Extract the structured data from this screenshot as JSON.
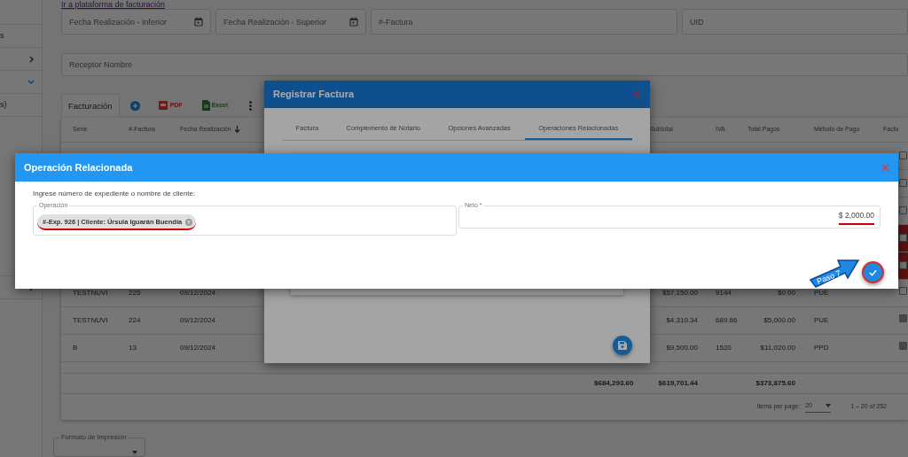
{
  "sidebar": {
    "items": [
      {
        "kind": "text",
        "label": "s"
      },
      {
        "kind": "group",
        "expanded": false
      },
      {
        "kind": "group",
        "expanded": true
      },
      {
        "kind": "text",
        "label": "s)"
      }
    ],
    "lower_items": [
      {
        "kind": "group",
        "expanded": false
      }
    ]
  },
  "link": "Ir a plataforma de facturación",
  "filters": [
    {
      "placeholder": "Fecha Realización - Inferior",
      "calendar": true
    },
    {
      "placeholder": "Fecha Realización - Superior",
      "calendar": true
    },
    {
      "placeholder": "#-Factura",
      "calendar": false
    },
    {
      "placeholder": "UID",
      "calendar": false
    }
  ],
  "receptor": {
    "placeholder": "Receptor Nombre"
  },
  "toolbar": {
    "tab": "Facturación",
    "pdf": "PDF",
    "excel": "Excel"
  },
  "table": {
    "columns": [
      {
        "label": "Serie",
        "sorted": false
      },
      {
        "label": "#-Factura",
        "sorted": false
      },
      {
        "label": "Fecha Realización",
        "sorted": true
      },
      {
        "label": "Subtotal",
        "sorted": false
      },
      {
        "label": "IVA",
        "sorted": false
      },
      {
        "label": "Total Pagos",
        "sorted": false
      },
      {
        "label": "Método de Pago",
        "sorted": false
      },
      {
        "label": "Factu",
        "sorted": false
      }
    ],
    "hidden_rows": [
      {
        "checked": false,
        "flagged": false
      },
      {
        "checked": false,
        "flagged": false
      },
      {
        "checked": false,
        "flagged": false
      },
      {
        "checked": false,
        "flagged": true
      },
      {
        "checked": false,
        "flagged": true
      }
    ],
    "rows": [
      {
        "serie": "TESTNUVI",
        "factura": "225",
        "fecha": "09/12/2024",
        "subtotal": "$57,150.00",
        "iva": "9144",
        "total_pagos": "$0.00",
        "metodo": "PUE",
        "checked": false
      },
      {
        "serie": "TESTNUVI",
        "factura": "224",
        "fecha": "09/12/2024",
        "subtotal": "$4,310.34",
        "iva": "689.66",
        "total_pagos": "$5,000.00",
        "metodo": "PUE",
        "checked": true
      },
      {
        "serie": "B",
        "factura": "13",
        "fecha": "09/12/2024",
        "subtotal": "$9,500.00",
        "iva": "1520",
        "total_pagos": "$11,020.00",
        "metodo": "PPD",
        "checked": true
      }
    ],
    "totals": {
      "column_4": "$684,293.60",
      "subtotal": "$619,701.44",
      "total_pagos": "$373,875.60"
    },
    "pagination": {
      "label": "Items per page:",
      "page_size": "20",
      "range": "1 – 20 of 252"
    }
  },
  "print_format": {
    "label": "Formato de Impresión"
  },
  "register_dialog": {
    "title": "Registrar Factura",
    "tabs": [
      {
        "label": "Factura",
        "selected": false
      },
      {
        "label": "Complemento de Notario",
        "selected": false
      },
      {
        "label": "Opciones Avanzadas",
        "selected": false
      },
      {
        "label": "Operaciones Relacionadas",
        "selected": true
      }
    ]
  },
  "operation_dialog": {
    "title": "Operación Relacionada",
    "prompt": "Ingrese número de expediente o nombre de cliente:",
    "operation_field": {
      "label": "Operación",
      "chip": "#-Exp. 926 | Cliente: Úrsula Iguarán Buendía"
    },
    "neto_field": {
      "label": "Neto *",
      "value": "$ 2,000.00"
    }
  },
  "callout": {
    "text": "Paso 7"
  }
}
